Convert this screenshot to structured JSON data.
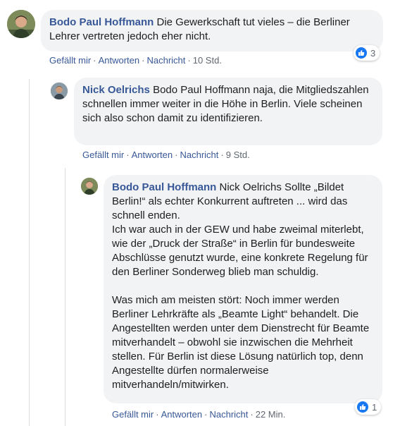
{
  "comments": [
    {
      "author": "Bodo Paul Hoffmann",
      "text": "Die Gewerkschaft tut vieles – die Berliner Lehrer vertreten jedoch eher nicht.",
      "like_label": "Gefällt mir",
      "reply_label": "Antworten",
      "message_label": "Nachricht",
      "time": "10 Std.",
      "reaction_count": "3"
    },
    {
      "author": "Nick Oelrichs",
      "text": "Bodo Paul Hoffmann naja, die Mitgliedszahlen schnellen immer weiter in die Höhe in Berlin. Viele scheinen sich also schon damit zu identifizieren.",
      "like_label": "Gefällt mir",
      "reply_label": "Antworten",
      "message_label": "Nachricht",
      "time": "9 Std."
    },
    {
      "author": "Bodo Paul Hoffmann",
      "text_p1": "Nick Oelrichs Sollte „Bildet Berlin!“ als echter Konkurrent auftreten ... wird das schnell enden.",
      "text_p2": "Ich war auch in der GEW und habe zweimal miterlebt, wie der „Druck der Straße“ in Berlin für bundesweite Abschlüsse genutzt wurde, eine konkrete Regelung für den Berliner Sonderweg blieb man schuldig.",
      "text_p3": "Was mich am meisten stört: Noch immer werden Berliner Lehrkräfte als „Beamte Light“ behandelt. Die Angestellten werden unter dem Dienstrecht für Beamte mitverhandelt – obwohl sie inzwischen die Mehrheit stellen. Für Berlin ist diese Lösung natürlich top, denn Angestellte dürfen normalerweise mitverhandeln/mitwirken.",
      "like_label": "Gefällt mir",
      "reply_label": "Antworten",
      "message_label": "Nachricht",
      "time": "22 Min.",
      "reaction_count": "1"
    }
  ],
  "separator": "·",
  "colors": {
    "author": "#385898",
    "bubble": "#f2f3f5",
    "like": "#1877f2",
    "meta": "#606770"
  }
}
